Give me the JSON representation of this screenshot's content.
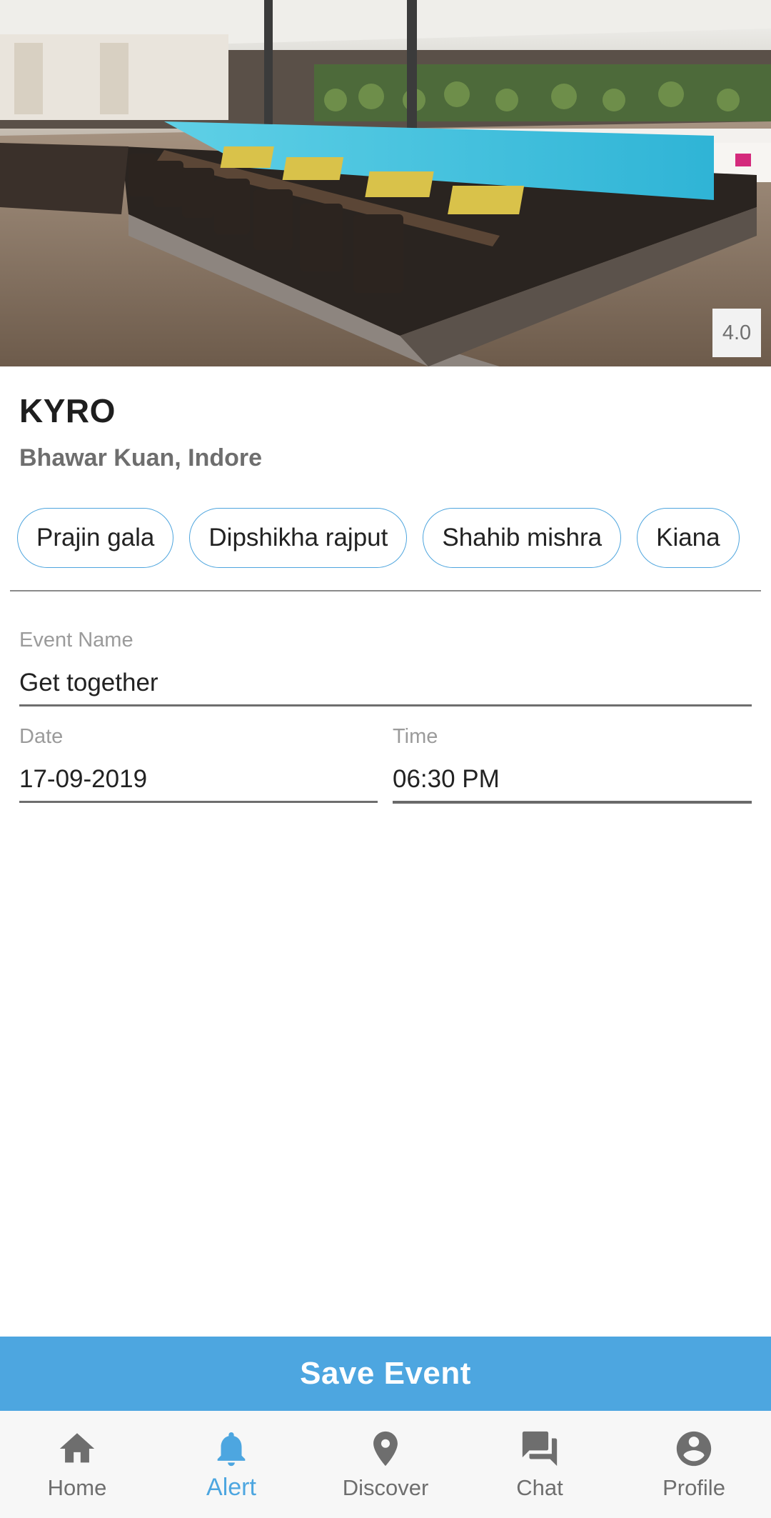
{
  "venue": {
    "rating": "4.0",
    "name": "KYRO",
    "location": "Bhawar Kuan, Indore"
  },
  "friends": [
    "Prajin gala",
    "Dipshikha rajput",
    "Shahib mishra",
    "Kiana"
  ],
  "form": {
    "event_name_label": "Event Name",
    "event_name_value": "Get together",
    "date_label": "Date",
    "date_value": "17-09-2019",
    "time_label": "Time",
    "time_value": "06:30 PM"
  },
  "save_button_label": "Save Event",
  "nav": {
    "active": "alert",
    "items": [
      {
        "label": "Home",
        "icon": "home-icon"
      },
      {
        "label": "Alert",
        "icon": "bell-icon"
      },
      {
        "label": "Discover",
        "icon": "location-pin-icon"
      },
      {
        "label": "Chat",
        "icon": "chat-icon"
      },
      {
        "label": "Profile",
        "icon": "profile-icon"
      }
    ]
  },
  "colors": {
    "accent": "#4da6e0",
    "chip_border": "#4ea5de",
    "nav_inactive": "#6e6e6e"
  }
}
